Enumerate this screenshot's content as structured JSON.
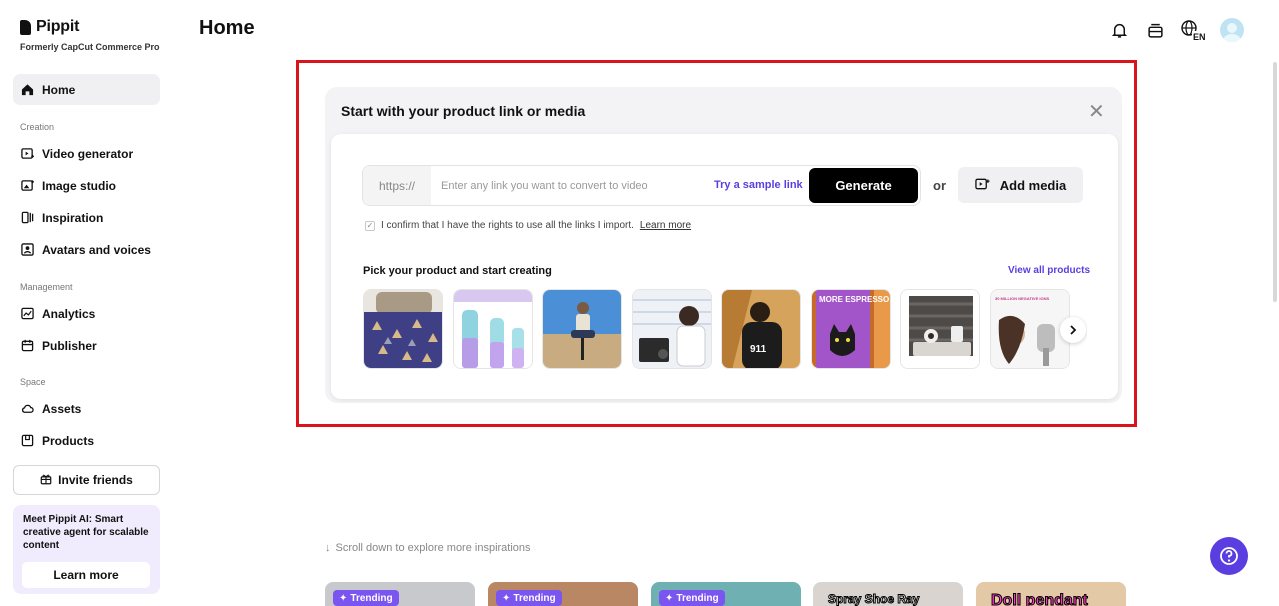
{
  "brand": {
    "name": "Pippit",
    "subtitle": "Formerly CapCut Commerce Pro"
  },
  "sidebar": {
    "home": "Home",
    "sections": {
      "creation": "Creation",
      "management": "Management",
      "space": "Space"
    },
    "creation_items": [
      {
        "label": "Video generator",
        "icon": "video-plus-icon"
      },
      {
        "label": "Image studio",
        "icon": "image-plus-icon"
      },
      {
        "label": "Inspiration",
        "icon": "inspiration-icon"
      },
      {
        "label": "Avatars and voices",
        "icon": "avatar-icon"
      }
    ],
    "management_items": [
      {
        "label": "Analytics",
        "icon": "analytics-icon"
      },
      {
        "label": "Publisher",
        "icon": "calendar-icon"
      }
    ],
    "space_items": [
      {
        "label": "Assets",
        "icon": "cloud-icon"
      },
      {
        "label": "Products",
        "icon": "box-icon"
      }
    ],
    "invite": "Invite friends",
    "promo": {
      "text": "Meet Pippit AI: Smart creative agent for scalable content",
      "button": "Learn more"
    }
  },
  "header": {
    "title": "Home",
    "icons": [
      "bell-icon",
      "subscription-icon",
      "language-icon",
      "avatar"
    ],
    "language_code": "EN"
  },
  "start_card": {
    "title": "Start with your product link or media",
    "https_prefix": "https://",
    "link_placeholder": "Enter any link you want to convert to video",
    "sample_link": "Try a sample link",
    "generate": "Generate",
    "or": "or",
    "add_media": "Add media",
    "confirm_text": "I confirm that I have the rights to use all the links I import.",
    "learn_more": "Learn more",
    "pick_title": "Pick your product and start creating",
    "view_all": "View all products",
    "thumb_texts": [
      "MORE ESPRESSO",
      "30 MILLION NEGATIVE IONS"
    ]
  },
  "scroll_hint": "Scroll down to explore more inspirations",
  "trending": {
    "badge": "Trending",
    "captions": [
      "Doll pendant",
      "Spray Shoe Ray"
    ]
  },
  "colors": {
    "accent": "#5a3ee0",
    "highlight": "#d9141b",
    "badge": "#7a55f0"
  }
}
